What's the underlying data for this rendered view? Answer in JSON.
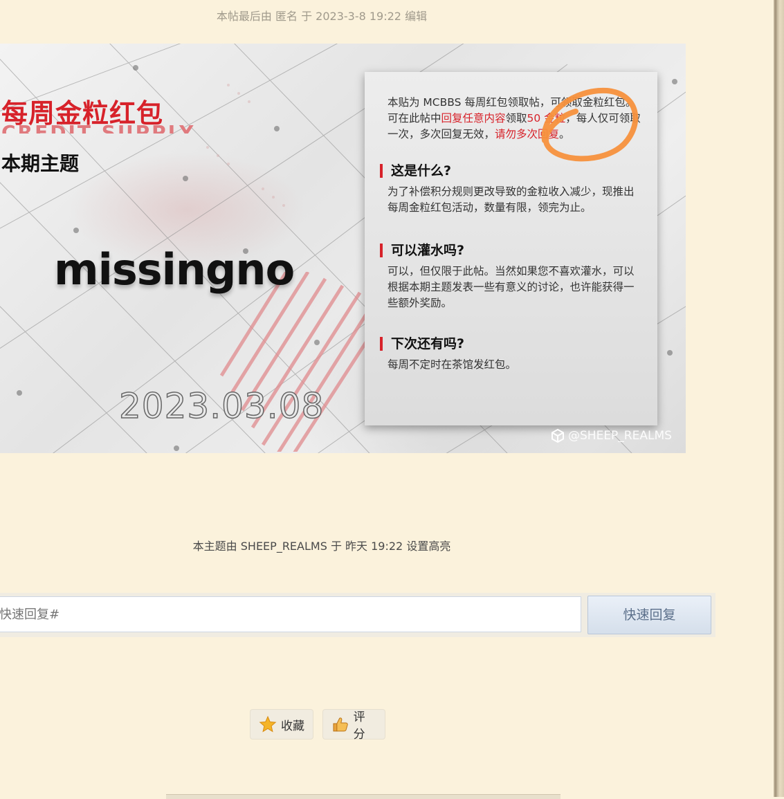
{
  "edit_note": "本帖最后由 匿名 于 2023-3-8 19:22 编辑",
  "banner": {
    "title": "每周金粒红包",
    "subtitle_en": "CREDIT SUPPLY",
    "theme_label": "本期主题",
    "theme_value": "missingno",
    "date": "2023.03.08",
    "watermark": "@SHEEP_REALMS",
    "card": {
      "intro_part1": "本贴为 MCBBS 每周红包领取帖，可领取金粒红包。可在此帖中",
      "intro_hl1": "回复任意内容",
      "intro_part2": "领取",
      "intro_hl2": "50 金粒",
      "intro_part3": "，每人仅可领取一次，多次回复无效，",
      "intro_hl3": "请勿多次回复",
      "intro_part4": "。",
      "q1_title": "这是什么?",
      "q1_body": "为了补偿积分规则更改导致的金粒收入减少，现推出每周金粒红包活动，数量有限，领完为止。",
      "q2_title": "可以灌水吗?",
      "q2_body": "可以，但仅限于此帖。当然如果您不喜欢灌水，可以根据本期主题发表一些有意义的讨论，也许能获得一些额外奖励。",
      "q3_title": "下次还有吗?",
      "q3_body": "每周不定时在茶馆发红包。"
    }
  },
  "highlight_note": "本主题由 SHEEP_REALMS 于 昨天 19:22 设置高亮",
  "quick_reply": {
    "placeholder": "快速回复#",
    "button_label": "快速回复"
  },
  "actions": {
    "favorite_label": "收藏",
    "rate_label": "评分"
  },
  "colors": {
    "page_bg": "#fbf2dc",
    "accent_red": "#d7222a",
    "annotation_orange": "#f7913d"
  }
}
